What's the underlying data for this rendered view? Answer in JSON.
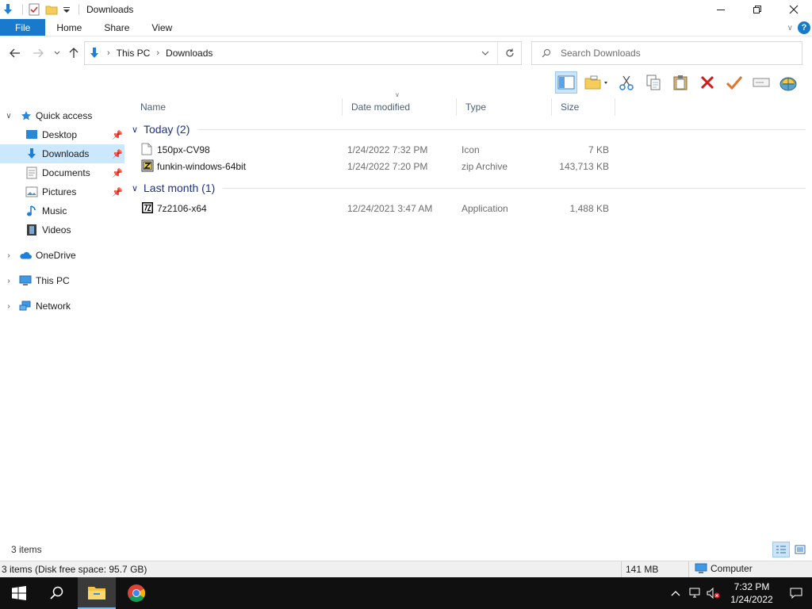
{
  "window": {
    "title": "Downloads"
  },
  "ribbon": {
    "tabs": [
      "File",
      "Home",
      "Share",
      "View"
    ]
  },
  "address": {
    "crumbs": [
      "This PC",
      "Downloads"
    ]
  },
  "search": {
    "placeholder": "Search Downloads"
  },
  "navpane": {
    "items": [
      {
        "label": "Quick access",
        "icon": "star-icon"
      },
      {
        "label": "Desktop",
        "icon": "desktop-icon",
        "pinned": true
      },
      {
        "label": "Downloads",
        "icon": "download-arrow-icon",
        "pinned": true,
        "selected": true
      },
      {
        "label": "Documents",
        "icon": "documents-icon",
        "pinned": true
      },
      {
        "label": "Pictures",
        "icon": "pictures-icon",
        "pinned": true
      },
      {
        "label": "Music",
        "icon": "music-icon"
      },
      {
        "label": "Videos",
        "icon": "videos-icon"
      },
      {
        "label": "OneDrive",
        "icon": "cloud-icon"
      },
      {
        "label": "This PC",
        "icon": "computer-icon"
      },
      {
        "label": "Network",
        "icon": "network-icon"
      }
    ]
  },
  "columns": [
    "Name",
    "Date modified",
    "Type",
    "Size"
  ],
  "groups": [
    {
      "label": "Today (2)",
      "files": [
        {
          "name": "150px-CV98",
          "date": "1/24/2022 7:32 PM",
          "type": "Icon",
          "size": "7 KB",
          "icon": "blank-file-icon"
        },
        {
          "name": "funkin-windows-64bit",
          "date": "1/24/2022 7:20 PM",
          "type": "zip Archive",
          "size": "143,713 KB",
          "icon": "zip-archive-icon"
        }
      ]
    },
    {
      "label": "Last month (1)",
      "files": [
        {
          "name": "7z2106-x64",
          "date": "12/24/2021 3:47 AM",
          "type": "Application",
          "size": "1,488 KB",
          "icon": "7zip-app-icon"
        }
      ]
    }
  ],
  "status": {
    "item_count": "3 items",
    "bar_left": "3 items (Disk free space: 95.7 GB)",
    "bar_size": "141 MB",
    "bar_location": "Computer"
  },
  "taskbar": {
    "time": "7:32 PM",
    "date": "1/24/2022"
  },
  "colors": {
    "accent": "#1979ca",
    "selection": "#cce8ff",
    "group_header": "#1e3287",
    "taskbar": "#101010"
  }
}
